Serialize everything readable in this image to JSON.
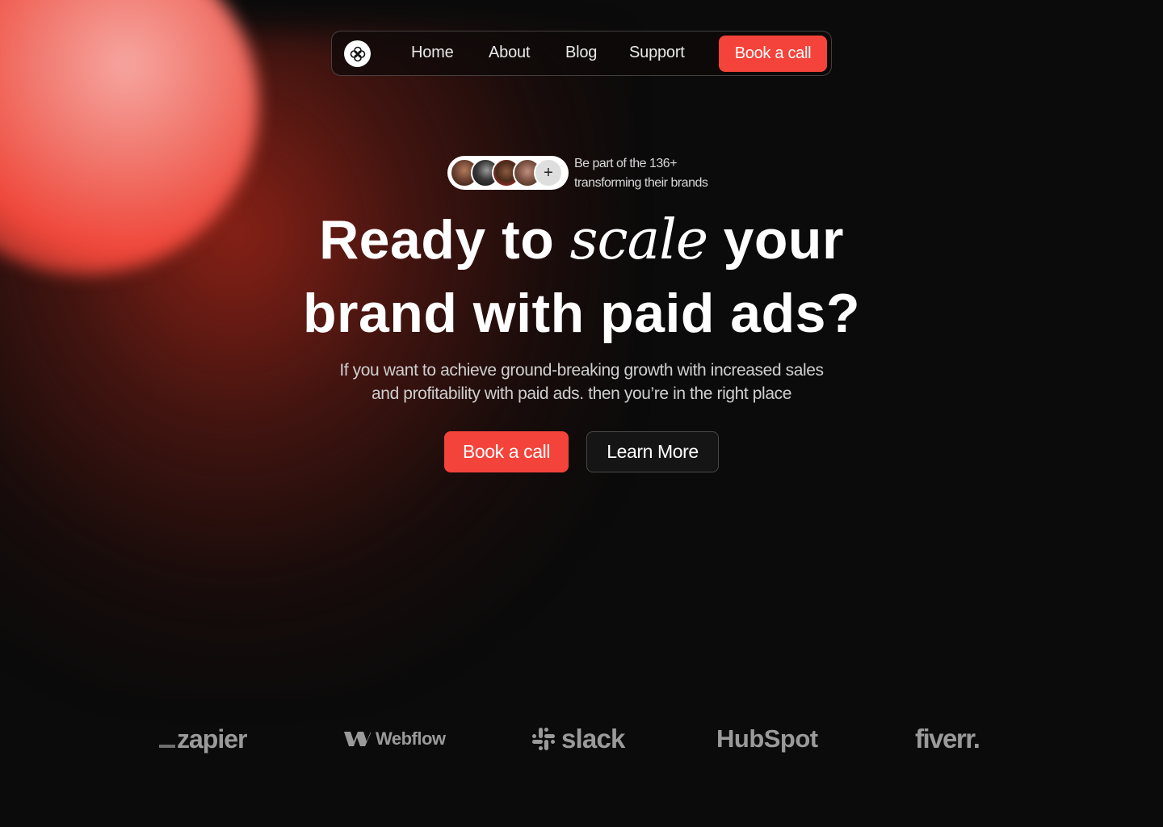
{
  "nav": {
    "logo_icon": "clover-icon",
    "links": [
      "Home",
      "About",
      "Blog",
      "Support"
    ],
    "cta_label": "Book a call"
  },
  "social_proof": {
    "line1": "Be part of the 136+",
    "line2": "transforming their brands",
    "plus_symbol": "+"
  },
  "hero": {
    "headline_part1": "Ready to ",
    "headline_accent": "scale",
    "headline_part2": " your",
    "headline_line2": "brand with paid ads?",
    "subtitle_line1": "If you want to achieve ground-breaking growth with increased sales",
    "subtitle_line2": "and profitability with paid ads. then you’re in the right place",
    "primary_button": "Book a call",
    "secondary_button": "Learn More"
  },
  "brands": {
    "zapier": "zapier",
    "webflow": "Webflow",
    "slack": "slack",
    "hubspot": "HubSpot",
    "fiverr": "fiverr."
  },
  "colors": {
    "accent": "#f4433a",
    "background": "#0b0b0b",
    "logo_gray": "#9a9a9a"
  }
}
